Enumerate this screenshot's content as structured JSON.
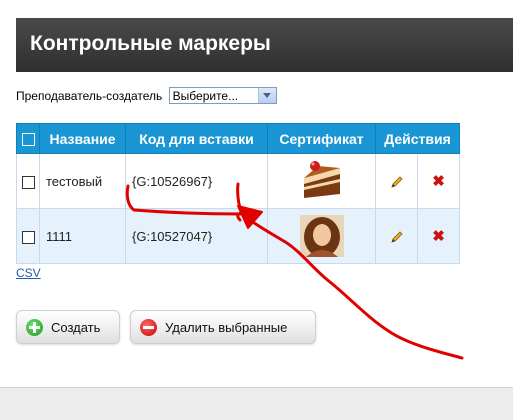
{
  "header": {
    "title": "Контрольные маркеры"
  },
  "filter": {
    "label": "Преподаватель-создатель",
    "select_value": "Выберите..."
  },
  "table": {
    "columns": [
      "Название",
      "Код для вставки",
      "Сертификат",
      "Действия"
    ],
    "rows": [
      {
        "name": "тестовый",
        "code": "{G:10526967}",
        "certificate": "cake-image"
      },
      {
        "name": "1111",
        "code": "{G:10527047}",
        "certificate": "portrait-image"
      }
    ]
  },
  "csv_link": "CSV",
  "buttons": {
    "create": "Создать",
    "delete": "Удалить выбранные"
  },
  "colors": {
    "header_bg": "#2f2f2f",
    "table_header": "#1a96d4",
    "annotation": "#e00000",
    "delete_x": "#cc1111"
  },
  "icons": [
    "pencil-icon",
    "delete-x-icon",
    "plus-icon",
    "minus-icon",
    "chevron-down-icon"
  ]
}
